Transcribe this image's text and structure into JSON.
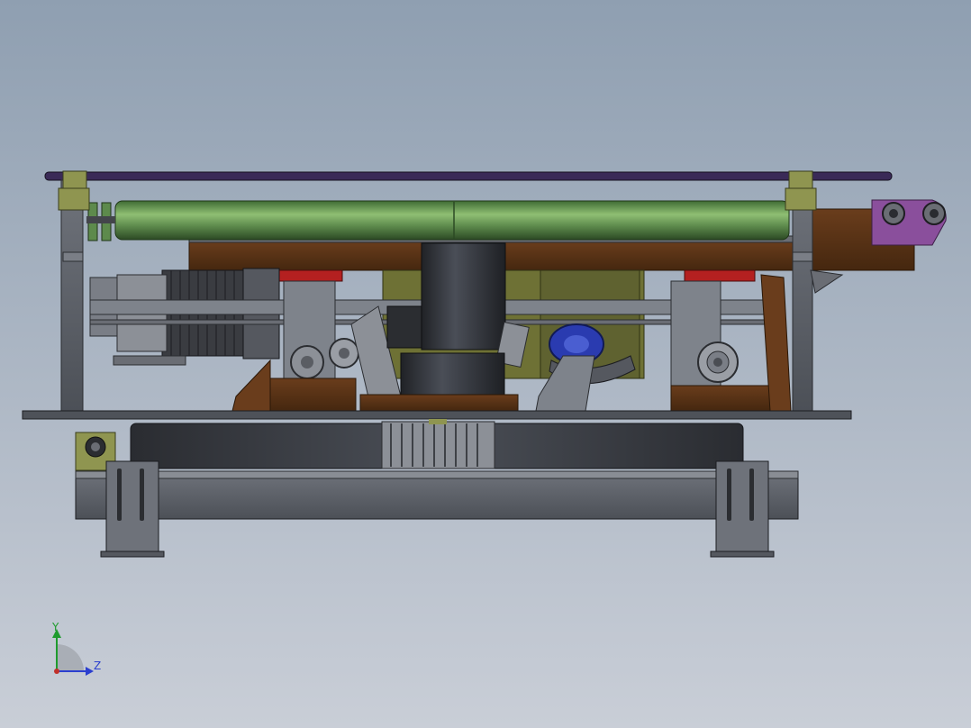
{
  "triad": {
    "y_label": "Y",
    "z_label": "Z",
    "y_color": "#1f9b2e",
    "z_color": "#2b3fcf",
    "origin_color": "#c0302a"
  },
  "colors": {
    "frame": "#5d6168",
    "roller": "#5d8a4c",
    "beam": "#5a3418",
    "rod": "#3a2a57",
    "clamp": "#8f9550",
    "bracket": "#8a4f9c",
    "block": "#b42020",
    "column": "#33363d",
    "bearing_blue": "#2a3bb0"
  }
}
